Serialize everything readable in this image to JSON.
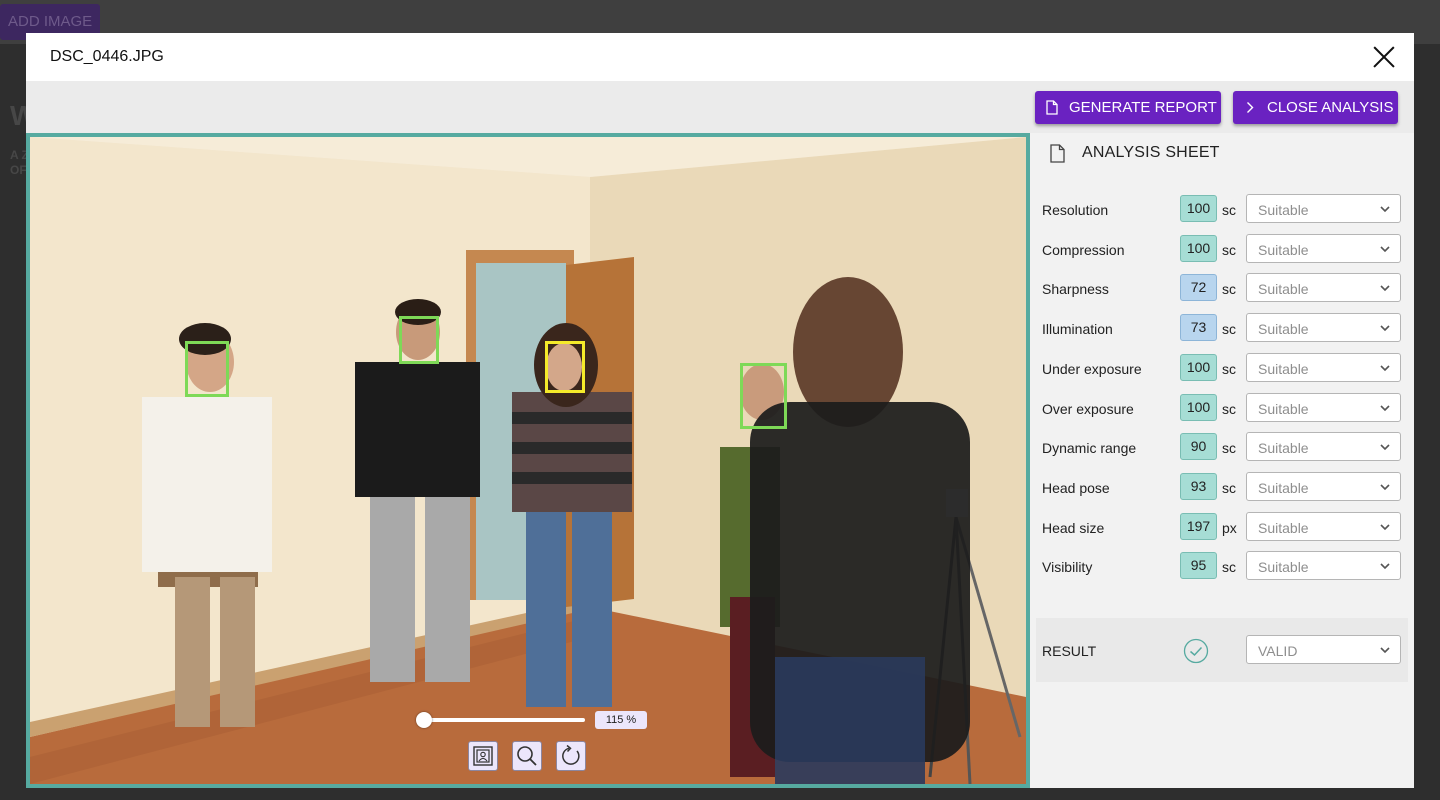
{
  "background": {
    "add_image_label": "ADD IMAGE",
    "heading_fragment": "W",
    "subtext_line1": "A Z",
    "subtext_line2": "OF"
  },
  "modal": {
    "title": "DSC_0446.JPG",
    "close_icon": "close-icon"
  },
  "toolbar": {
    "generate_report_label": "GENERATE REPORT",
    "generate_report_icon": "document-icon",
    "close_analysis_label": "CLOSE ANALYSIS",
    "close_analysis_icon": "chevron-right-icon"
  },
  "viewer": {
    "zoom_level": 115,
    "zoom_label": "115 %",
    "controls": [
      "portrait-frame-icon",
      "zoom-icon",
      "rotate-icon"
    ],
    "face_detections": [
      {
        "id": 1,
        "status": "ok",
        "color": "#7ed957"
      },
      {
        "id": 2,
        "status": "ok",
        "color": "#7ed957"
      },
      {
        "id": 3,
        "status": "selected",
        "color": "#f4ea2a"
      },
      {
        "id": 4,
        "status": "ok",
        "color": "#7ed957"
      }
    ]
  },
  "sheet": {
    "title": "ANALYSIS SHEET",
    "rows": [
      {
        "label": "Resolution",
        "score": "100",
        "unit": "sc",
        "value": "Suitable",
        "tone": "green"
      },
      {
        "label": "Compression",
        "score": "100",
        "unit": "sc",
        "value": "Suitable",
        "tone": "green"
      },
      {
        "label": "Sharpness",
        "score": "72",
        "unit": "sc",
        "value": "Suitable",
        "tone": "blue"
      },
      {
        "label": "Illumination",
        "score": "73",
        "unit": "sc",
        "value": "Suitable",
        "tone": "blue"
      },
      {
        "label": "Under exposure",
        "score": "100",
        "unit": "sc",
        "value": "Suitable",
        "tone": "green"
      },
      {
        "label": "Over exposure",
        "score": "100",
        "unit": "sc",
        "value": "Suitable",
        "tone": "green"
      },
      {
        "label": "Dynamic range",
        "score": "90",
        "unit": "sc",
        "value": "Suitable",
        "tone": "green"
      },
      {
        "label": "Head pose",
        "score": "93",
        "unit": "sc",
        "value": "Suitable",
        "tone": "green"
      },
      {
        "label": "Head size",
        "score": "197",
        "unit": "px",
        "value": "Suitable",
        "tone": "green"
      },
      {
        "label": "Visibility",
        "score": "95",
        "unit": "sc",
        "value": "Suitable",
        "tone": "green"
      }
    ],
    "result": {
      "label": "RESULT",
      "icon": "check-circle-icon",
      "value": "VALID"
    }
  },
  "colors": {
    "accent": "#6a22c1",
    "viewer_border": "#56aaa0",
    "score_green": "#a6ddd5",
    "score_blue": "#b8d5ee"
  }
}
